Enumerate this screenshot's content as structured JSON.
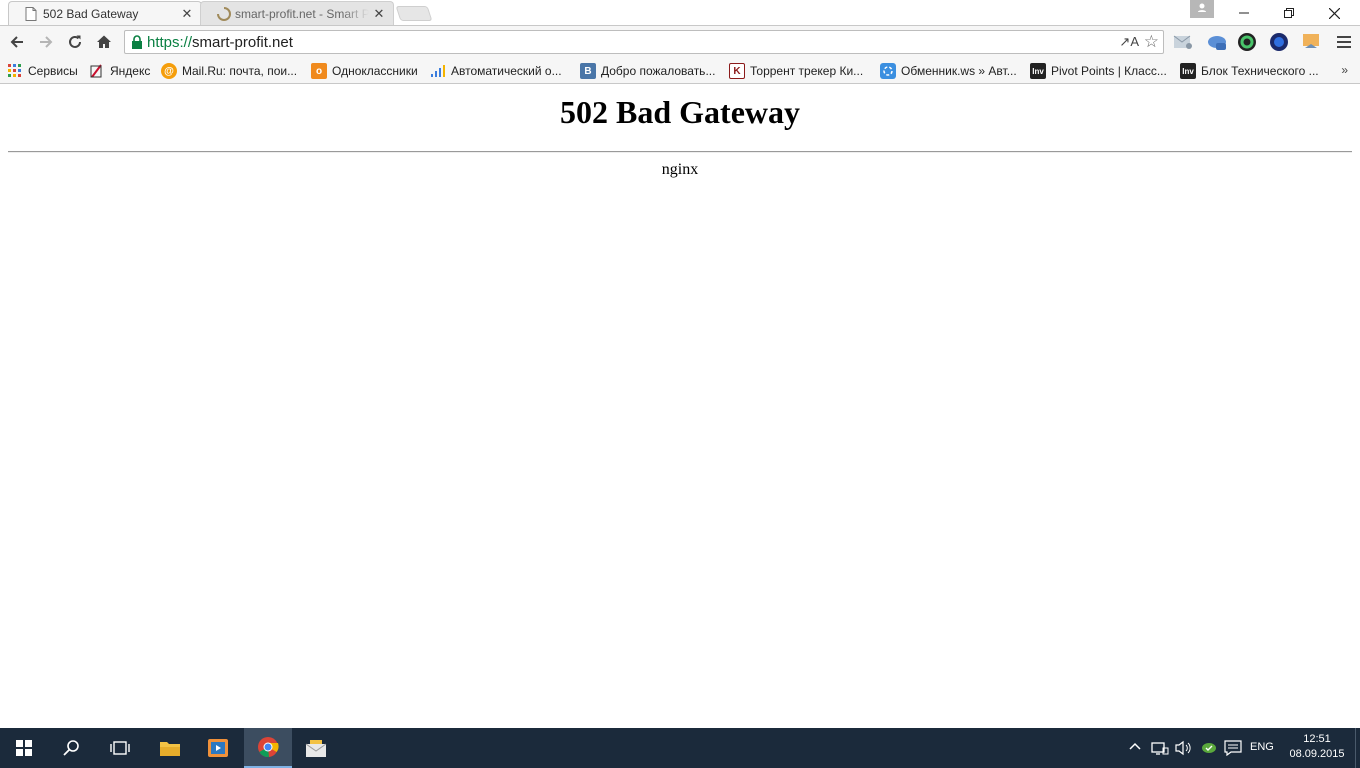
{
  "browser": {
    "tabs": [
      {
        "title": "502 Bad Gateway",
        "active": true
      },
      {
        "title": "smart-profit.net - Smart P",
        "active": false
      }
    ],
    "address": {
      "scheme": "https://",
      "host": "smart-profit.net"
    },
    "translate_label": "↗A"
  },
  "bookmarks": [
    {
      "label": "Сервисы",
      "icon": "apps-grid-icon"
    },
    {
      "label": "Яндекс",
      "icon": "yandex-icon"
    },
    {
      "label": "Mail.Ru: почта, пои...",
      "icon": "mailru-icon"
    },
    {
      "label": "Одноклассники",
      "icon": "odnoklassniki-icon"
    },
    {
      "label": "Автоматический о...",
      "icon": "bars-icon"
    },
    {
      "label": "Добро пожаловать...",
      "icon": "vk-icon"
    },
    {
      "label": "Торрент трекер Ки...",
      "icon": "kinozal-icon"
    },
    {
      "label": "Обменник.ws » Авт...",
      "icon": "exchanger-icon"
    },
    {
      "label": "Pivot Points | Класс...",
      "icon": "investing-icon"
    },
    {
      "label": "Блок Технического ...",
      "icon": "investing-icon"
    }
  ],
  "bookmarks_more": "»",
  "page": {
    "heading": "502 Bad Gateway",
    "server": "nginx"
  },
  "taskbar": {
    "language": "ENG",
    "time": "12:51",
    "date": "08.09.2015"
  },
  "colors": {
    "secure_scheme": "#0b8043",
    "taskbar_bg": "#1b2a3b",
    "chrome_bg": "#f6f6f6"
  }
}
